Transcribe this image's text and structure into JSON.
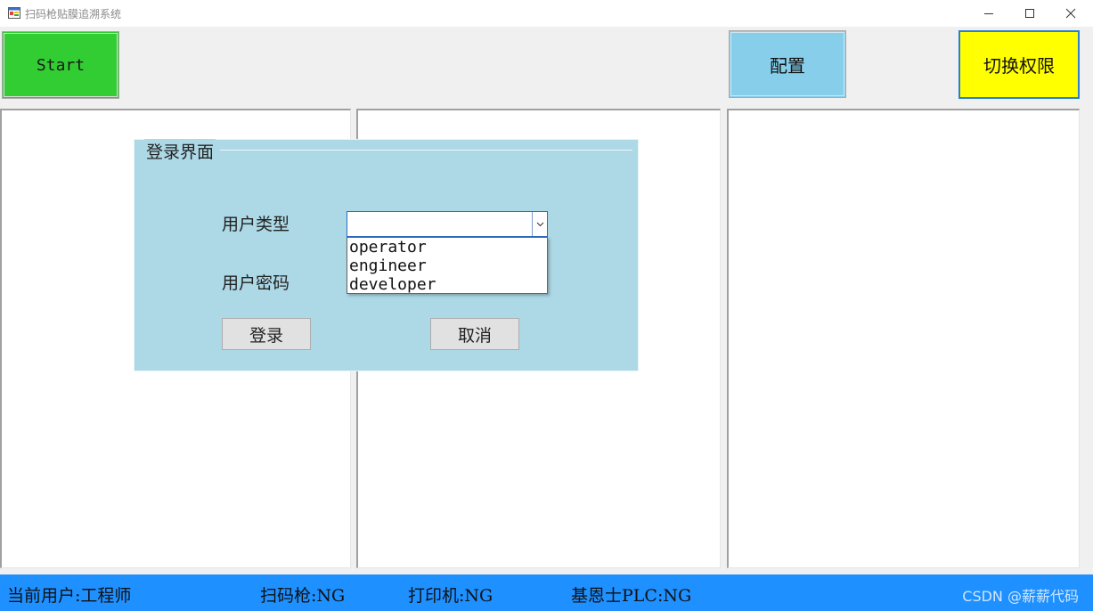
{
  "window": {
    "title": "扫码枪贴膜追溯系统",
    "icon": "app-window-icon",
    "controls": [
      "minimize-icon",
      "maximize-icon",
      "close-icon"
    ]
  },
  "toolbar": {
    "start_label": "Start",
    "config_label": "配置",
    "switch_permission_label": "切换权限",
    "colors": {
      "start": "#32cd32",
      "config": "#87ceeb",
      "switch": "#ffff00"
    }
  },
  "login_dialog": {
    "title": "登录界面",
    "user_type_label": "用户类型",
    "user_type_value": "",
    "user_type_options": [
      "operator",
      "engineer",
      "developer"
    ],
    "password_label": "用户密码",
    "login_button": "登录",
    "cancel_button": "取消"
  },
  "status_bar": {
    "current_user": "当前用户:工程师",
    "scanner": "扫码枪:NG",
    "printer": "打印机:NG",
    "plc": "基恩士PLC:NG",
    "watermark": "CSDN @薪薪代码",
    "color": "#1e90ff"
  }
}
